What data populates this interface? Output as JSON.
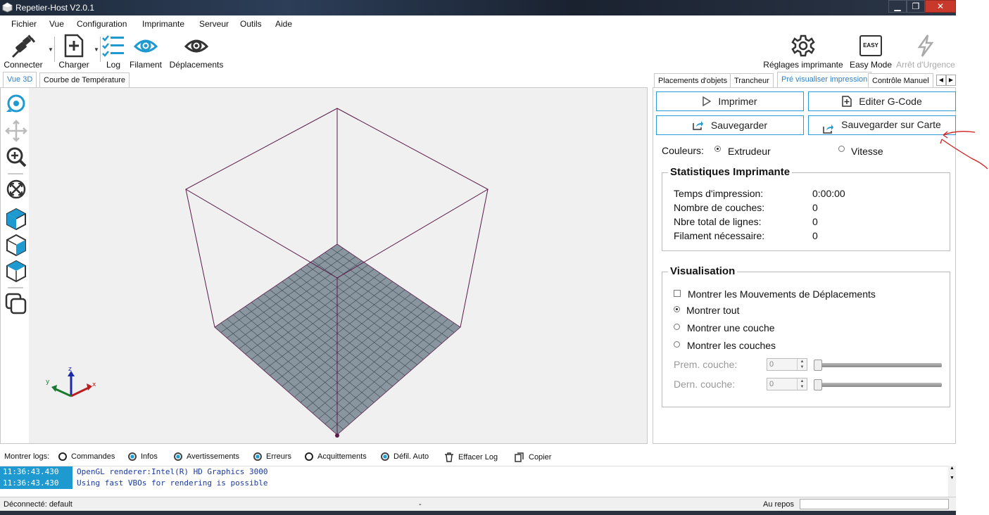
{
  "window": {
    "title": "Repetier-Host V2.0.1"
  },
  "menu": [
    "Fichier",
    "Vue",
    "Configuration",
    "Imprimante",
    "Serveur",
    "Outils",
    "Aide"
  ],
  "toolbar": {
    "connect": "Connecter",
    "load": "Charger",
    "log": "Log",
    "filament": "Filament",
    "moves": "Déplacements",
    "printer_settings": "Réglages imprimante",
    "easy_mode": "Easy Mode",
    "easy_badge": "EASY",
    "emergency": "Arrêt d'Urgence"
  },
  "left_tabs": [
    "Vue 3D",
    "Courbe de Température"
  ],
  "right_tabs": [
    "Placements d'objets",
    "Trancheur",
    "Pré visualiser impression",
    "Contrôle Manuel"
  ],
  "preview": {
    "print_btn": "Imprimer",
    "edit_gcode_btn": "Editer G-Code",
    "save_btn": "Sauvegarder",
    "save_card_btn": "Sauvegarder sur Carte",
    "colors_label": "Couleurs:",
    "color_extruder": "Extrudeur",
    "color_speed": "Vitesse",
    "stats_title": "Statistiques Imprimante",
    "stats": [
      {
        "label": "Temps d'impression:",
        "value": "0:00:00"
      },
      {
        "label": "Nombre de couches:",
        "value": "0"
      },
      {
        "label": "Nbre total de lignes:",
        "value": "0"
      },
      {
        "label": "Filament nécessaire:",
        "value": "0"
      }
    ],
    "vis_title": "Visualisation",
    "show_travel": "Montrer les Mouvements de Déplacements",
    "show_all": "Montrer tout",
    "show_one": "Montrer une couche",
    "show_layers": "Montrer les couches",
    "first_layer_label": "Prem. couche:",
    "last_layer_label": "Dern. couche:",
    "first_layer_value": "0",
    "last_layer_value": "0"
  },
  "logbar": {
    "label": "Montrer logs:",
    "commands": "Commandes",
    "infos": "Infos",
    "warnings": "Avertissements",
    "errors": "Erreurs",
    "acks": "Acquittements",
    "autoscroll": "Défil. Auto",
    "clear": "Effacer Log",
    "copy": "Copier"
  },
  "log": [
    {
      "time": "11:36:43.430",
      "msg": "OpenGL renderer:Intel(R) HD Graphics 3000"
    },
    {
      "time": "11:36:43.430",
      "msg": "Using fast VBOs for rendering is possible"
    }
  ],
  "status": {
    "left": "Déconnecté: default",
    "middle": "-",
    "right": "Au repos"
  },
  "colors": {
    "accent": "#1e9ad0",
    "plate": "#8a969f",
    "frame": "#5a1a4a"
  }
}
